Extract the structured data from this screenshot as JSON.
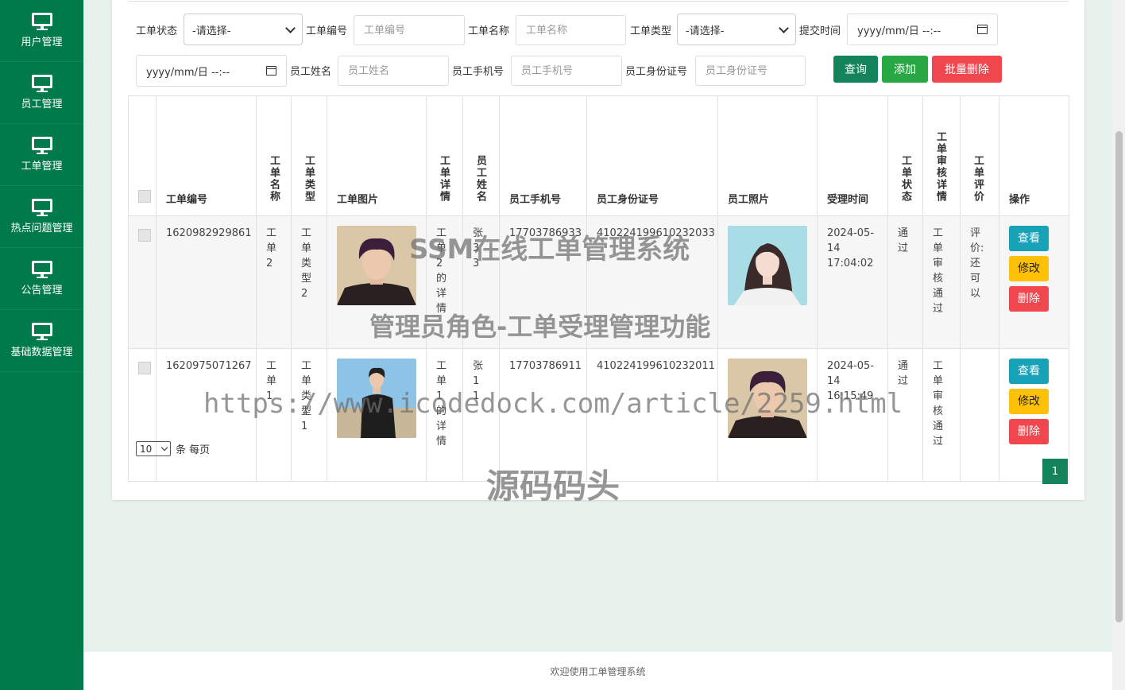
{
  "sidebar": {
    "items": [
      {
        "label": "用户管理",
        "icon": "monitor-icon"
      },
      {
        "label": "员工管理",
        "icon": "monitor-icon"
      },
      {
        "label": "工单管理",
        "icon": "monitor-icon"
      },
      {
        "label": "热点问题管理",
        "icon": "monitor-icon"
      },
      {
        "label": "公告管理",
        "icon": "monitor-icon"
      },
      {
        "label": "基础数据管理",
        "icon": "monitor-icon"
      }
    ]
  },
  "filters": {
    "status_label": "工单状态",
    "status_value": "-请选择-",
    "number_label": "工单编号",
    "number_placeholder": "工单编号",
    "name_label": "工单名称",
    "name_placeholder": "工单名称",
    "type_label": "工单类型",
    "type_value": "-请选择-",
    "submit_time_label": "提交时间",
    "submit_time_start": "yyyy/mm/日 --:--",
    "submit_time_end": "yyyy/mm/日 --:--",
    "employee_name_label": "员工姓名",
    "employee_name_placeholder": "员工姓名",
    "employee_phone_label": "员工手机号",
    "employee_phone_placeholder": "员工手机号",
    "employee_id_label": "员工身份证号",
    "employee_id_placeholder": "员工身份证号"
  },
  "toolbar": {
    "query_label": "查询",
    "add_label": "添加",
    "bulk_delete_label": "批量删除"
  },
  "table": {
    "headers": {
      "number": "工单编号",
      "name": "工单名称",
      "type": "工单类型",
      "image": "工单图片",
      "detail": "工单详情",
      "emp_name": "员工姓名",
      "emp_phone": "员工手机号",
      "emp_id": "员工身份证号",
      "emp_photo": "员工照片",
      "accept_time": "受理时间",
      "status": "工单状态",
      "review": "工单审核详情",
      "rating": "工单评价",
      "actions": "操作"
    },
    "rows": [
      {
        "number": "1620982929861",
        "name": "工单2",
        "type": "工单类型2",
        "detail": "工单2的详情",
        "emp_name": "张33",
        "emp_phone": "17703786933",
        "emp_id": "410224199610232033",
        "accept_time": "2024-05-14 17:04:02",
        "status": "通过",
        "review": "工单审核通过",
        "rating": "评价:还可以"
      },
      {
        "number": "1620975071267",
        "name": "工单1",
        "type": "工单类型1",
        "detail": "工单1的详情",
        "emp_name": "张11",
        "emp_phone": "17703786911",
        "emp_id": "410224199610232011",
        "accept_time": "2024-05-14 16:15:49",
        "status": "通过",
        "review": "工单审核通过",
        "rating": ""
      }
    ],
    "action_view": "查看",
    "action_edit": "修改",
    "action_delete": "删除"
  },
  "pagination": {
    "page_size": "10",
    "page_size_suffix": "条 每页",
    "current_page": "1"
  },
  "footer": {
    "text": "欢迎使用工单管理系统"
  },
  "watermarks": {
    "line1": "SSM在线工单管理系统",
    "line2": "管理员角色-工单受理管理功能",
    "line3": "https://www.icodedock.com/article/2259.html",
    "line4": "源码码头"
  },
  "colors": {
    "primary": "#007a4b",
    "accent": "#13835a",
    "danger": "#f0474e",
    "warning": "#ffc107",
    "info": "#17a2b8"
  }
}
